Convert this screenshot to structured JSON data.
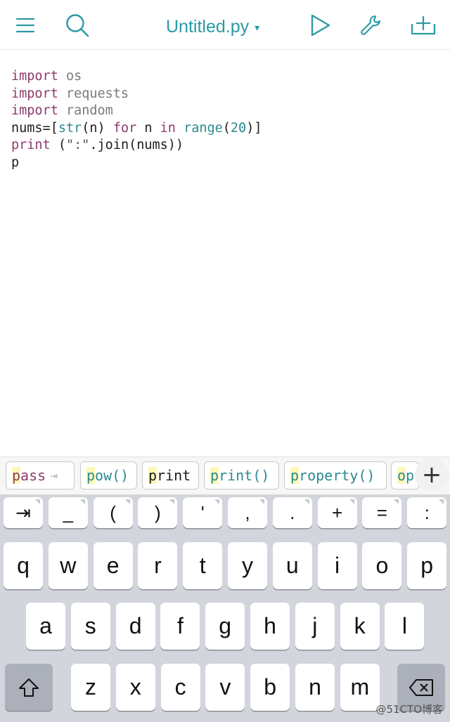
{
  "toolbar": {
    "title": "Untitled.py",
    "caret": "▾",
    "icons": [
      "menu-icon",
      "search-icon",
      "run-icon",
      "wrench-icon",
      "add-icon"
    ]
  },
  "editor": {
    "lines": [
      [
        {
          "t": "import",
          "c": "kw"
        },
        {
          "t": " os",
          "c": "id"
        }
      ],
      [
        {
          "t": "import",
          "c": "kw"
        },
        {
          "t": " requests",
          "c": "id"
        }
      ],
      [
        {
          "t": "import",
          "c": "kw"
        },
        {
          "t": " random",
          "c": "id"
        }
      ],
      [
        {
          "t": "nums=[",
          "c": ""
        },
        {
          "t": "str",
          "c": "fn"
        },
        {
          "t": "(n) ",
          "c": ""
        },
        {
          "t": "for",
          "c": "kw"
        },
        {
          "t": " n ",
          "c": ""
        },
        {
          "t": "in",
          "c": "kw"
        },
        {
          "t": " ",
          "c": ""
        },
        {
          "t": "range",
          "c": "fn"
        },
        {
          "t": "(",
          "c": ""
        },
        {
          "t": "20",
          "c": "num"
        },
        {
          "t": ")]",
          "c": ""
        }
      ],
      [
        {
          "t": "print",
          "c": "kw"
        },
        {
          "t": " (",
          "c": ""
        },
        {
          "t": "\":\"",
          "c": "str"
        },
        {
          "t": ".join(nums))",
          "c": ""
        }
      ],
      [
        {
          "t": "p",
          "c": ""
        }
      ]
    ]
  },
  "suggestions": [
    {
      "first": "p",
      "rest": "ass",
      "style": "kw-chip",
      "tab": "⇥"
    },
    {
      "first": "p",
      "rest": "ow()",
      "style": "fn-chip",
      "tab": ""
    },
    {
      "first": "p",
      "rest": "rint",
      "style": "plain-chip",
      "tab": ""
    },
    {
      "first": "p",
      "rest": "rint()",
      "style": "fn-chip",
      "tab": ""
    },
    {
      "first": "p",
      "rest": "roperty()",
      "style": "fn-chip",
      "tab": ""
    },
    {
      "first": "o",
      "rest": "p",
      "style": "fn-chip",
      "tab": ""
    }
  ],
  "suggest_plus": "+",
  "keyboard": {
    "symbols": [
      "⇥",
      "_",
      "(",
      ")",
      "'",
      ",",
      ".",
      "+",
      "=",
      ":"
    ],
    "row1": [
      "q",
      "w",
      "e",
      "r",
      "t",
      "y",
      "u",
      "i",
      "o",
      "p"
    ],
    "row2": [
      "a",
      "s",
      "d",
      "f",
      "g",
      "h",
      "j",
      "k",
      "l"
    ],
    "row3": [
      "z",
      "x",
      "c",
      "v",
      "b",
      "n",
      "m"
    ],
    "shift": "⇧",
    "delete": "⌫"
  },
  "watermark": "@51CTO博客"
}
